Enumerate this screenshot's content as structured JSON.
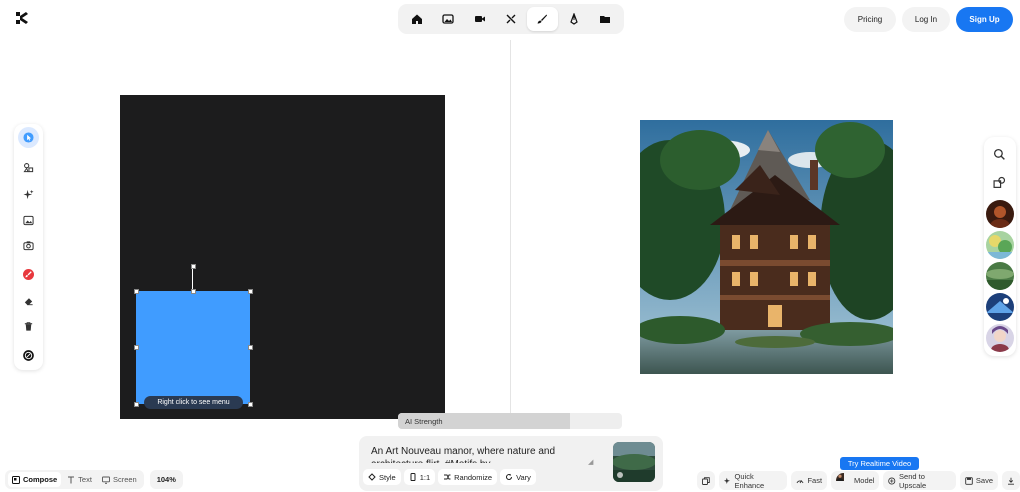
{
  "header": {
    "logo": "krea-logo",
    "modes": [
      {
        "name": "home",
        "icon": "home-icon",
        "active": false
      },
      {
        "name": "image",
        "icon": "image-icon",
        "active": false
      },
      {
        "name": "video",
        "icon": "video-camera-icon",
        "active": false
      },
      {
        "name": "enhance",
        "icon": "enhance-icon",
        "active": false
      },
      {
        "name": "realtime",
        "icon": "brush-icon",
        "active": true
      },
      {
        "name": "edit",
        "icon": "pen-nib-icon",
        "active": false
      },
      {
        "name": "assets",
        "icon": "folder-icon",
        "active": false
      }
    ],
    "pricing": "Pricing",
    "login": "Log In",
    "signup": "Sign Up"
  },
  "left_toolbar": [
    {
      "icon": "cursor-icon",
      "active": true,
      "accent": "#409cff"
    },
    {
      "icon": "shapes-icon"
    },
    {
      "icon": "sparkle-icon"
    },
    {
      "icon": "image-icon"
    },
    {
      "icon": "camera-icon"
    },
    {
      "icon": "paint-brush-icon",
      "accent": "#e8383d"
    },
    {
      "icon": "eraser-icon"
    },
    {
      "icon": "trash-icon"
    },
    {
      "icon": "color-picker-icon"
    }
  ],
  "canvas": {
    "background_color": "#1c1c1d",
    "shape_color": "#409cff",
    "context_tip": "Right click to see menu"
  },
  "right_panel": {
    "icons": [
      "search-icon",
      "shapes-icon"
    ],
    "thumbnails": [
      "dark-portrait-thumb",
      "fantasy-garden-thumb",
      "green-landscape-thumb",
      "blue-futuristic-thumb",
      "anime-character-thumb"
    ]
  },
  "strength": {
    "label": "AI Strength",
    "value": 0.77
  },
  "prompt": {
    "text": "An Art Nouveau manor, where nature and architecture flirt, #Motifs by...",
    "buttons": {
      "style": "Style",
      "ratio": "1:1",
      "randomize": "Randomize",
      "vary": "Vary"
    }
  },
  "bottom_left": {
    "compose": "Compose",
    "text": "Text",
    "screen": "Screen",
    "zoom": "104%"
  },
  "bottom_right": {
    "realtime_video": "Try Realtime Video",
    "quick_enhance": "Quick Enhance",
    "fast": "Fast",
    "model": "Model",
    "send_to_upscale": "Send to Upscale",
    "save": "Save"
  },
  "colors": {
    "accent": "#1877f2",
    "shape": "#409cff",
    "brush": "#e8383d"
  }
}
